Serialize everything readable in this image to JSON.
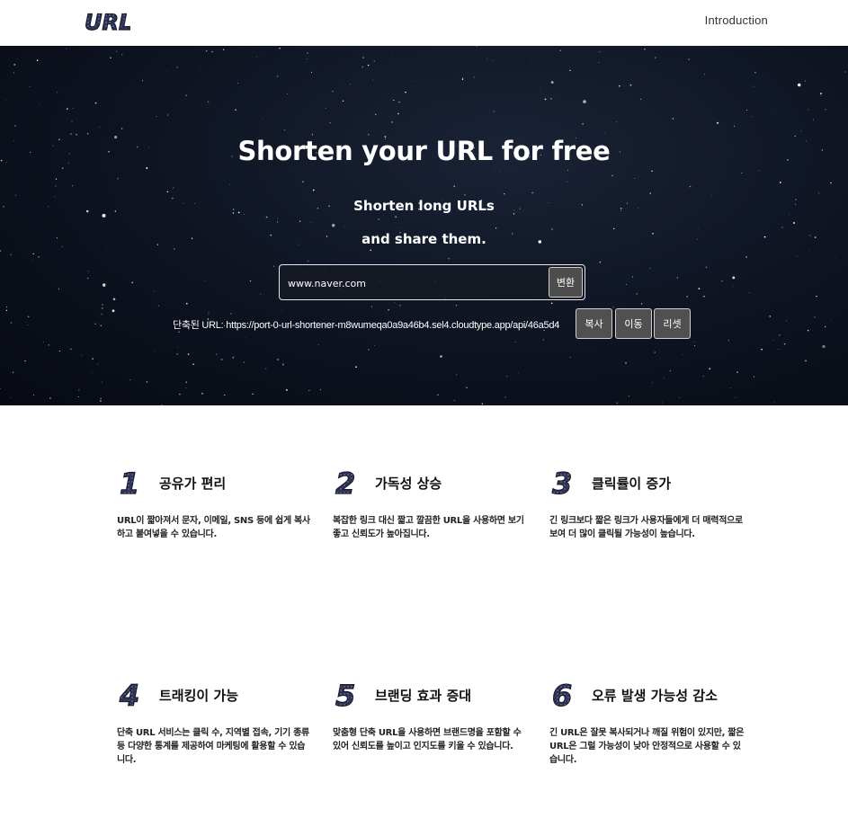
{
  "header": {
    "logo_text": "URL",
    "nav": {
      "introduction": "Introduction"
    }
  },
  "hero": {
    "title": "Shorten your URL for free",
    "subtitle_line1": "Shorten long URLs",
    "subtitle_line2": "and share them.",
    "input": {
      "value": "www.naver.com",
      "placeholder": ""
    },
    "convert_label": "변환",
    "result_text": "단축된 URL: https://port-0-url-shortener-m8wumeqa0a9a46b4.sel4.cloudtype.app/api/46a5d4",
    "copy_label": "복사",
    "go_label": "이동",
    "reset_label": "리셋"
  },
  "features": [
    {
      "number": "1",
      "title": "공유가 편리",
      "desc": "URL이 짧아져서 문자, 이메일, SNS 등에 쉽게 복사하고 붙여넣을 수 있습니다."
    },
    {
      "number": "2",
      "title": "가독성 상승",
      "desc": "복잡한 링크 대신 짧고 깔끔한 URL을 사용하면 보기 좋고 신뢰도가 높아집니다."
    },
    {
      "number": "3",
      "title": "클릭률이 증가",
      "desc": "긴 링크보다 짧은 링크가 사용자들에게 더 매력적으로 보여 더 많이 클릭될 가능성이 높습니다."
    },
    {
      "number": "4",
      "title": "트래킹이 가능",
      "desc": "단축 URL 서비스는 클릭 수, 지역별 접속, 기기 종류 등 다양한 통계를 제공하여 마케팅에 활용할 수 있습니다."
    },
    {
      "number": "5",
      "title": "브랜딩 효과 증대",
      "desc": "맞춤형 단축 URL을 사용하면 브랜드명을 포함할 수 있어 신뢰도를 높이고 인지도를 키울 수 있습니다."
    },
    {
      "number": "6",
      "title": "오류 발생 가능성 감소",
      "desc": "긴 URL은 잘못 복사되거나 깨질 위험이 있지만, 짧은 URL은 그럴 가능성이 낮아 안정적으로 사용할 수 있습니다."
    }
  ],
  "colors": {
    "hero_bg": "#0d1320",
    "button_bg": "#4d4d4d",
    "sparkle_fill": "#2a2f55"
  }
}
